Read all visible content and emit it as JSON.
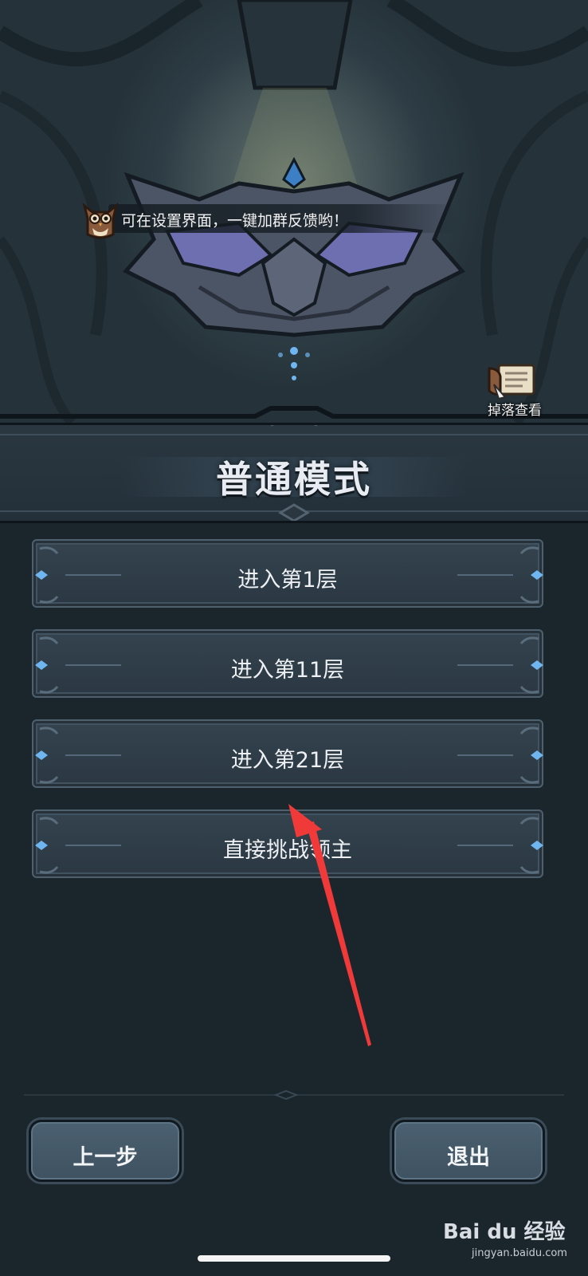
{
  "tip": {
    "text": "可在设置界面，一键加群反馈哟！"
  },
  "drop_view": {
    "label": "掉落查看"
  },
  "mode": {
    "title": "普通模式"
  },
  "floors": [
    {
      "label": "进入第1层"
    },
    {
      "label": "进入第11层"
    },
    {
      "label": "进入第21层"
    },
    {
      "label": "直接挑战领主"
    }
  ],
  "footer": {
    "prev_label": "上一步",
    "exit_label": "退出"
  },
  "watermark": {
    "brand": "Bai du 经验",
    "url": "jingyan.baidu.com"
  },
  "colors": {
    "accent_arrow": "#f03a3a",
    "gem_blue": "#6fb6f0"
  }
}
